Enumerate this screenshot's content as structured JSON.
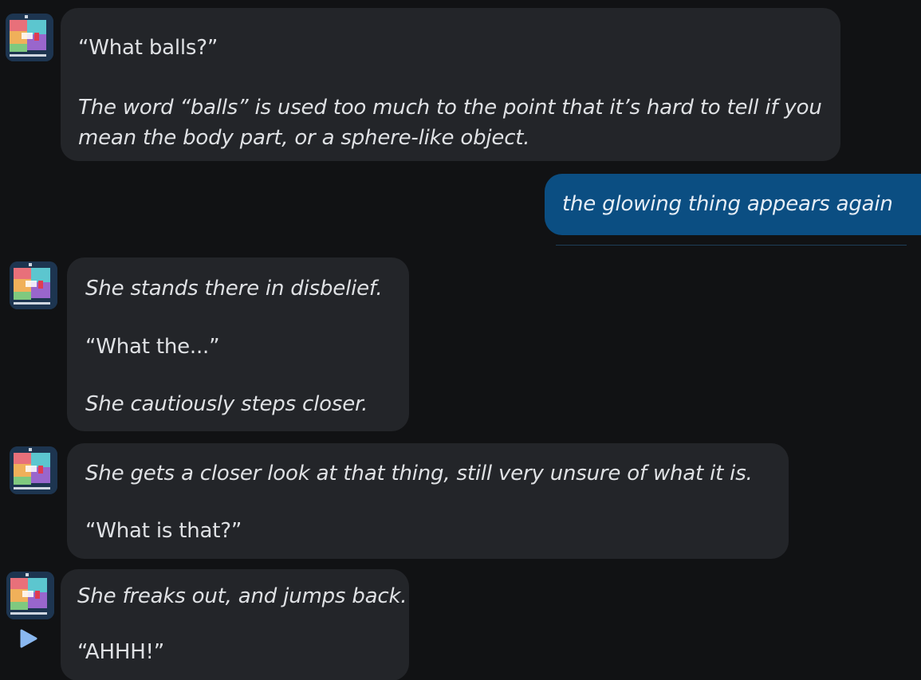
{
  "colors": {
    "background": "#111214",
    "bot_bubble": "#232529",
    "user_bubble": "#0b4e82",
    "text": "#dfe1e4",
    "play_accent": "#8ab8f0"
  },
  "avatar": {
    "icon": "pixel-art-avatar-icon"
  },
  "messages": [
    {
      "role": "bot",
      "paragraphs": [
        {
          "text": "“What balls?”",
          "style": "normal"
        },
        {
          "text": "The word “balls” is used too much to the point that it’s hard to tell if you mean the body part, or a sphere-like object.",
          "style": "italic"
        }
      ]
    },
    {
      "role": "user",
      "paragraphs": [
        {
          "text": "the glowing thing appears again",
          "style": "italic"
        }
      ]
    },
    {
      "role": "bot",
      "paragraphs": [
        {
          "text": "She stands there in disbelief.",
          "style": "italic"
        },
        {
          "text": "“What the...”",
          "style": "normal"
        },
        {
          "text": "She cautiously steps closer.",
          "style": "italic"
        }
      ]
    },
    {
      "role": "bot",
      "paragraphs": [
        {
          "text": "She gets a closer look at that thing, still very unsure of what it is.",
          "style": "italic"
        },
        {
          "text": "“What is that?”",
          "style": "normal"
        }
      ]
    },
    {
      "role": "bot",
      "paragraphs": [
        {
          "text": "She freaks out, and jumps back.",
          "style": "italic"
        },
        {
          "text": "“AHHH!”",
          "style": "normal"
        }
      ]
    }
  ],
  "play_button": {
    "icon": "play-icon"
  }
}
